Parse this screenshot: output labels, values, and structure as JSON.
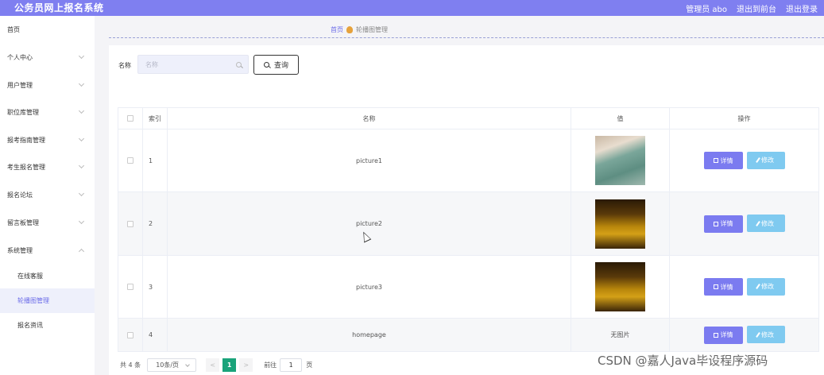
{
  "header": {
    "title": "公务员网上报名系统",
    "admin_label": "管理员 abo",
    "goto_front": "退出到前台",
    "logout": "退出登录"
  },
  "sidebar": {
    "items": [
      {
        "label": "首页"
      },
      {
        "label": "个人中心"
      },
      {
        "label": "用户管理"
      },
      {
        "label": "职位库管理"
      },
      {
        "label": "报考指南管理"
      },
      {
        "label": "考生报名管理"
      },
      {
        "label": "报名论坛"
      },
      {
        "label": "留言板管理"
      },
      {
        "label": "系统管理"
      }
    ],
    "subitems": [
      {
        "label": "在线客服"
      },
      {
        "label": "轮播图管理",
        "active": true
      },
      {
        "label": "报名资讯"
      }
    ]
  },
  "breadcrumb": {
    "home": "首页",
    "current": "轮播图管理"
  },
  "search": {
    "label": "名称",
    "placeholder": "名称",
    "value": "",
    "button": "查询"
  },
  "table": {
    "headers": {
      "index": "索引",
      "name": "名称",
      "value": "值",
      "actions": "操作"
    },
    "rows": [
      {
        "index": "1",
        "name": "picture1",
        "value": "",
        "image": "bedroom-photo"
      },
      {
        "index": "2",
        "name": "picture2",
        "value": "",
        "image": "city-photo"
      },
      {
        "index": "3",
        "name": "picture3",
        "value": "",
        "image": "city-photo"
      },
      {
        "index": "4",
        "name": "homepage",
        "value": "无图片",
        "image": ""
      }
    ],
    "detail_label": "详情",
    "edit_label": "修改"
  },
  "pagination": {
    "total": "共 4 条",
    "page_size": "10条/页",
    "prev": "<",
    "next": ">",
    "current": "1",
    "goto_label": "前往",
    "goto_value": "1",
    "page_word": "页"
  },
  "watermark": "CSDN @嘉人Java毕设程序源码"
}
